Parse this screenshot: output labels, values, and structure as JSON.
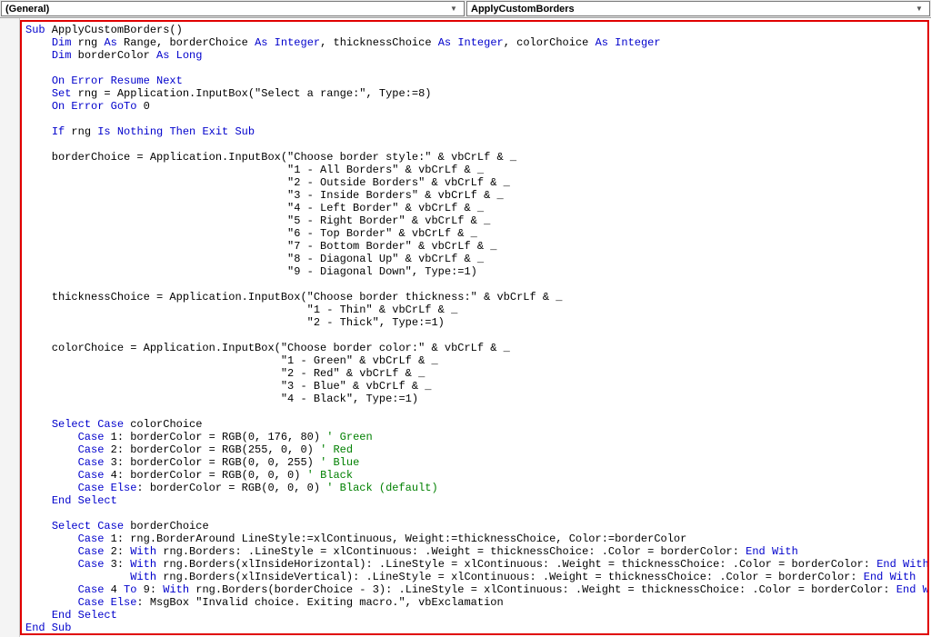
{
  "dropdowns": {
    "object": "(General)",
    "procedure": "ApplyCustomBorders"
  },
  "code": {
    "lines": [
      [
        [
          "kw",
          "Sub"
        ],
        [
          "",
          " ApplyCustomBorders()"
        ]
      ],
      [
        [
          "",
          "    "
        ],
        [
          "kw",
          "Dim"
        ],
        [
          "",
          " rng "
        ],
        [
          "kw",
          "As"
        ],
        [
          "",
          " Range, borderChoice "
        ],
        [
          "kw",
          "As Integer"
        ],
        [
          "",
          ", thicknessChoice "
        ],
        [
          "kw",
          "As Integer"
        ],
        [
          "",
          ", colorChoice "
        ],
        [
          "kw",
          "As Integer"
        ]
      ],
      [
        [
          "",
          "    "
        ],
        [
          "kw",
          "Dim"
        ],
        [
          "",
          " borderColor "
        ],
        [
          "kw",
          "As Long"
        ]
      ],
      [
        [
          "",
          ""
        ]
      ],
      [
        [
          "",
          "    "
        ],
        [
          "kw",
          "On Error Resume Next"
        ]
      ],
      [
        [
          "",
          "    "
        ],
        [
          "kw",
          "Set"
        ],
        [
          "",
          " rng = Application.InputBox(\"Select a range:\", Type:=8)"
        ]
      ],
      [
        [
          "",
          "    "
        ],
        [
          "kw",
          "On Error GoTo"
        ],
        [
          "",
          " 0"
        ]
      ],
      [
        [
          "",
          ""
        ]
      ],
      [
        [
          "",
          "    "
        ],
        [
          "kw",
          "If"
        ],
        [
          "",
          " rng "
        ],
        [
          "kw",
          "Is Nothing Then Exit Sub"
        ]
      ],
      [
        [
          "",
          ""
        ]
      ],
      [
        [
          "",
          "    borderChoice = Application.InputBox(\"Choose border style:\" & vbCrLf & _"
        ]
      ],
      [
        [
          "",
          "                                        \"1 - All Borders\" & vbCrLf & _"
        ]
      ],
      [
        [
          "",
          "                                        \"2 - Outside Borders\" & vbCrLf & _"
        ]
      ],
      [
        [
          "",
          "                                        \"3 - Inside Borders\" & vbCrLf & _"
        ]
      ],
      [
        [
          "",
          "                                        \"4 - Left Border\" & vbCrLf & _"
        ]
      ],
      [
        [
          "",
          "                                        \"5 - Right Border\" & vbCrLf & _"
        ]
      ],
      [
        [
          "",
          "                                        \"6 - Top Border\" & vbCrLf & _"
        ]
      ],
      [
        [
          "",
          "                                        \"7 - Bottom Border\" & vbCrLf & _"
        ]
      ],
      [
        [
          "",
          "                                        \"8 - Diagonal Up\" & vbCrLf & _"
        ]
      ],
      [
        [
          "",
          "                                        \"9 - Diagonal Down\", Type:=1)"
        ]
      ],
      [
        [
          "",
          ""
        ]
      ],
      [
        [
          "",
          "    thicknessChoice = Application.InputBox(\"Choose border thickness:\" & vbCrLf & _"
        ]
      ],
      [
        [
          "",
          "                                           \"1 - Thin\" & vbCrLf & _"
        ]
      ],
      [
        [
          "",
          "                                           \"2 - Thick\", Type:=1)"
        ]
      ],
      [
        [
          "",
          ""
        ]
      ],
      [
        [
          "",
          "    colorChoice = Application.InputBox(\"Choose border color:\" & vbCrLf & _"
        ]
      ],
      [
        [
          "",
          "                                       \"1 - Green\" & vbCrLf & _"
        ]
      ],
      [
        [
          "",
          "                                       \"2 - Red\" & vbCrLf & _"
        ]
      ],
      [
        [
          "",
          "                                       \"3 - Blue\" & vbCrLf & _"
        ]
      ],
      [
        [
          "",
          "                                       \"4 - Black\", Type:=1)"
        ]
      ],
      [
        [
          "",
          ""
        ]
      ],
      [
        [
          "",
          "    "
        ],
        [
          "kw",
          "Select Case"
        ],
        [
          "",
          " colorChoice"
        ]
      ],
      [
        [
          "",
          "        "
        ],
        [
          "kw",
          "Case"
        ],
        [
          "",
          " 1: borderColor = RGB(0, 176, 80) "
        ],
        [
          "cm",
          "' Green"
        ]
      ],
      [
        [
          "",
          "        "
        ],
        [
          "kw",
          "Case"
        ],
        [
          "",
          " 2: borderColor = RGB(255, 0, 0) "
        ],
        [
          "cm",
          "' Red"
        ]
      ],
      [
        [
          "",
          "        "
        ],
        [
          "kw",
          "Case"
        ],
        [
          "",
          " 3: borderColor = RGB(0, 0, 255) "
        ],
        [
          "cm",
          "' Blue"
        ]
      ],
      [
        [
          "",
          "        "
        ],
        [
          "kw",
          "Case"
        ],
        [
          "",
          " 4: borderColor = RGB(0, 0, 0) "
        ],
        [
          "cm",
          "' Black"
        ]
      ],
      [
        [
          "",
          "        "
        ],
        [
          "kw",
          "Case Else"
        ],
        [
          "",
          ": borderColor = RGB(0, 0, 0) "
        ],
        [
          "cm",
          "' Black (default)"
        ]
      ],
      [
        [
          "",
          "    "
        ],
        [
          "kw",
          "End Select"
        ]
      ],
      [
        [
          "",
          ""
        ]
      ],
      [
        [
          "",
          "    "
        ],
        [
          "kw",
          "Select Case"
        ],
        [
          "",
          " borderChoice"
        ]
      ],
      [
        [
          "",
          "        "
        ],
        [
          "kw",
          "Case"
        ],
        [
          "",
          " 1: rng.BorderAround LineStyle:=xlContinuous, Weight:=thicknessChoice, Color:=borderColor"
        ]
      ],
      [
        [
          "",
          "        "
        ],
        [
          "kw",
          "Case"
        ],
        [
          "",
          " 2: "
        ],
        [
          "kw",
          "With"
        ],
        [
          "",
          " rng.Borders: .LineStyle = xlContinuous: .Weight = thicknessChoice: .Color = borderColor: "
        ],
        [
          "kw",
          "End With"
        ]
      ],
      [
        [
          "",
          "        "
        ],
        [
          "kw",
          "Case"
        ],
        [
          "",
          " 3: "
        ],
        [
          "kw",
          "With"
        ],
        [
          "",
          " rng.Borders(xlInsideHorizontal): .LineStyle = xlContinuous: .Weight = thicknessChoice: .Color = borderColor: "
        ],
        [
          "kw",
          "End With"
        ]
      ],
      [
        [
          "",
          "                "
        ],
        [
          "kw",
          "With"
        ],
        [
          "",
          " rng.Borders(xlInsideVertical): .LineStyle = xlContinuous: .Weight = thicknessChoice: .Color = borderColor: "
        ],
        [
          "kw",
          "End With"
        ]
      ],
      [
        [
          "",
          "        "
        ],
        [
          "kw",
          "Case"
        ],
        [
          "",
          " 4 "
        ],
        [
          "kw",
          "To"
        ],
        [
          "",
          " 9: "
        ],
        [
          "kw",
          "With"
        ],
        [
          "",
          " rng.Borders(borderChoice - 3): .LineStyle = xlContinuous: .Weight = thicknessChoice: .Color = borderColor: "
        ],
        [
          "kw",
          "End With"
        ]
      ],
      [
        [
          "",
          "        "
        ],
        [
          "kw",
          "Case Else"
        ],
        [
          "",
          ": MsgBox \"Invalid choice. Exiting macro.\", vbExclamation"
        ]
      ],
      [
        [
          "",
          "    "
        ],
        [
          "kw",
          "End Select"
        ]
      ],
      [
        [
          "kw",
          "End Sub"
        ]
      ]
    ]
  }
}
